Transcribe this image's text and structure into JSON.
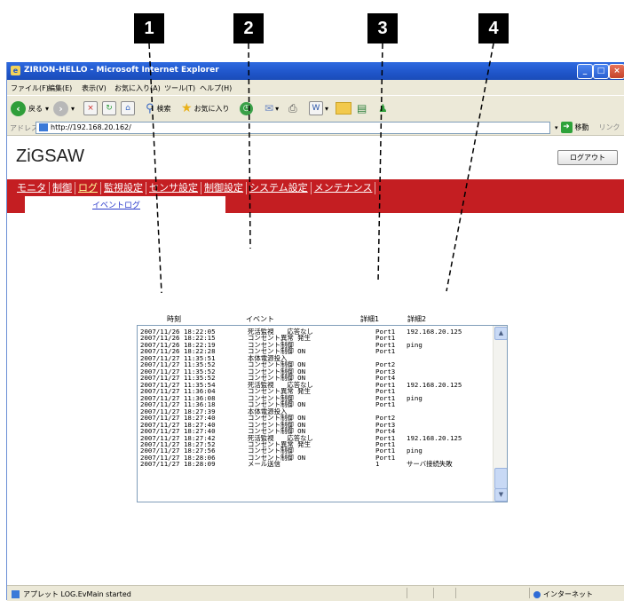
{
  "callouts": [
    "1",
    "2",
    "3",
    "4"
  ],
  "window": {
    "title": "ZIRION-HELLO - Microsoft Internet Explorer",
    "controls": [
      "_",
      "□",
      "×"
    ]
  },
  "menubar": [
    "ファイル(F)",
    "編集(E)",
    "表示(V)",
    "お気に入り(A)",
    "ツール(T)",
    "ヘルプ(H)"
  ],
  "toolbar": {
    "back": "戻る",
    "search": "検索",
    "favorites": "お気に入り"
  },
  "address": {
    "label": "アドレス(D)",
    "url": "http://192.168.20.162/",
    "go": "移動",
    "links": "リンク"
  },
  "page": {
    "logo": "ZiGSAW",
    "logout": "ログアウト",
    "tabs": [
      "モニタ",
      "制御",
      "ログ",
      "監視設定",
      "センサ設定",
      "制御設定",
      "システム設定",
      "メンテナンス"
    ],
    "active_tab": "ログ",
    "subtab": "イベントログ",
    "columns": [
      "時刻",
      "イベント",
      "詳細1",
      "詳細2"
    ],
    "rows": [
      [
        "2007/11/26 18:22:05",
        "死活監視　　応答なし",
        "Port1",
        "192.168.20.125"
      ],
      [
        "2007/11/26 18:22:15",
        "コンセント異常 発生",
        "Port1",
        ""
      ],
      [
        "2007/11/26 18:22:19",
        "コンセント制御",
        "Port1",
        "ping"
      ],
      [
        "2007/11/26 18:22:28",
        "コンセント制御 ON",
        "Port1",
        ""
      ],
      [
        "2007/11/27 11:35:51",
        "本体電源投入",
        "",
        ""
      ],
      [
        "2007/11/27 11:35:52",
        "コンセント制御 ON",
        "Port2",
        ""
      ],
      [
        "2007/11/27 11:35:52",
        "コンセント制御 ON",
        "Port3",
        ""
      ],
      [
        "2007/11/27 11:35:52",
        "コンセント制御 ON",
        "Port4",
        ""
      ],
      [
        "2007/11/27 11:35:54",
        "死活監視　　応答なし",
        "Port1",
        "192.168.20.125"
      ],
      [
        "2007/11/27 11:36:04",
        "コンセント異常 発生",
        "Port1",
        ""
      ],
      [
        "2007/11/27 11:36:08",
        "コンセント制御",
        "Port1",
        "ping"
      ],
      [
        "2007/11/27 11:36:18",
        "コンセント制御 ON",
        "Port1",
        ""
      ],
      [
        "2007/11/27 18:27:39",
        "本体電源投入",
        "",
        ""
      ],
      [
        "2007/11/27 18:27:40",
        "コンセント制御 ON",
        "Port2",
        ""
      ],
      [
        "2007/11/27 18:27:40",
        "コンセント制御 ON",
        "Port3",
        ""
      ],
      [
        "2007/11/27 18:27:40",
        "コンセント制御 ON",
        "Port4",
        ""
      ],
      [
        "2007/11/27 18:27:42",
        "死活監視　　応答なし",
        "Port1",
        "192.168.20.125"
      ],
      [
        "2007/11/27 18:27:52",
        "コンセント異常 発生",
        "Port1",
        ""
      ],
      [
        "2007/11/27 18:27:56",
        "コンセント制御",
        "Port1",
        "ping"
      ],
      [
        "2007/11/27 18:28:06",
        "コンセント制御 ON",
        "Port1",
        ""
      ],
      [
        "2007/11/27 18:28:09",
        "メール送信",
        "1",
        "サーバ接続失敗"
      ]
    ]
  },
  "status": {
    "text": "アプレット LOG.EvMain started",
    "zone": "インターネット"
  },
  "colors": {
    "nav_red": "#c41e22",
    "title_blue": "#2e6ae0",
    "chrome": "#ece9d8"
  }
}
